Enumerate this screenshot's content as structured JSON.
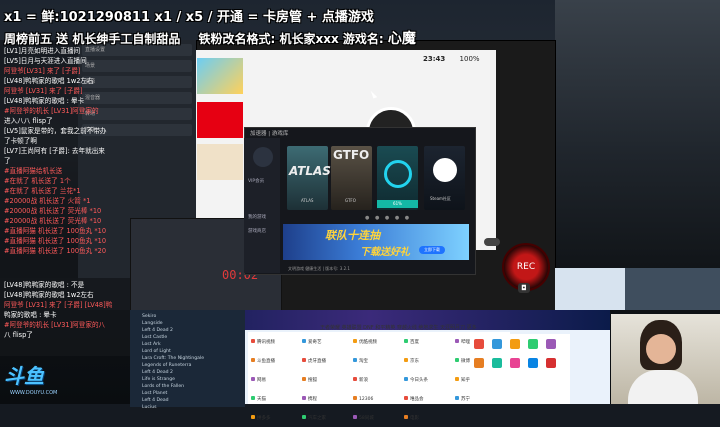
{
  "banner": {
    "line1": "x1 = 鲜:1021290811  x1 / x5 / 开通 = 卡房管 + 点播游戏",
    "line2_a": "周榜前五 送 机长绅手工自制甜品",
    "line2_b": "铁粉改名格式: 机长家xxx 游戏名:",
    "line2_name": "心魔"
  },
  "chat": {
    "lines": [
      {
        "text": "[LV1]月亮如明进入直播间",
        "color": "white"
      },
      {
        "text": "[LV5]日月与天涯进入直播间",
        "color": "white"
      },
      {
        "text": "阿登爷[LV31] 来了 [子爵]",
        "color": "red"
      },
      {
        "text": "[LV48]鸭鸭家的歌唱  1w2左右",
        "color": "white"
      },
      {
        "text": "阿登爷 [LV31] 来了 [子爵]",
        "color": "red"
      },
      {
        "text": "[LV48]鸭鸭家的歌唱 : 晕卡",
        "color": "white"
      },
      {
        "text": "#阿登爷的机长 [LV31]阿登家的",
        "color": "red"
      },
      {
        "text": "进入八八 flisp了",
        "color": "white"
      },
      {
        "text": "[LV5]鼠家是带的，套我之前不带办",
        "color": "white"
      },
      {
        "text": "了卡顿了啊",
        "color": "white"
      },
      {
        "text": "[LV7]王尚阿有 [子爵]: 去年就出来",
        "color": "white"
      },
      {
        "text": "了",
        "color": "white"
      },
      {
        "text": "#直播阿猫给机长送",
        "color": "red"
      },
      {
        "text": "#在就了 机长送了 1个",
        "color": "red"
      },
      {
        "text": "#在就了 机长送了 兰花*1",
        "color": "red"
      },
      {
        "text": "#20000战 机长送了 火箭 *1",
        "color": "red"
      },
      {
        "text": "#20000战 机长送了 荧光棒 *10",
        "color": "red"
      },
      {
        "text": "#20000战 机长送了 荧光棒 *10",
        "color": "red"
      },
      {
        "text": "#直播阿猫 机长送了 100鱼丸 *10",
        "color": "red"
      },
      {
        "text": "#直播阿猫 机长送了 100鱼丸 *10",
        "color": "red"
      },
      {
        "text": "#直播阿猫 机长送了 100鱼丸 *20",
        "color": "red"
      }
    ],
    "lower_lines": [
      {
        "text": "[LV48]鸭鸭家的歌唱 : 不是",
        "color": "white"
      },
      {
        "text": "[LV48]鸭鸭家的歌唱  1w2左右",
        "color": "white"
      },
      {
        "text": "阿登爷 [LV31] 来了 [子爵] [LV48]鸭",
        "color": "red"
      },
      {
        "text": "鸭家的歌唱 : 晕卡",
        "color": "white"
      },
      {
        "text": "#阿登爷的机长 [LV31]阿登家的八",
        "color": "red"
      },
      {
        "text": "八 flisp了",
        "color": "white"
      }
    ]
  },
  "midstrip": {
    "rows": [
      "直播设置",
      "场景",
      "来源",
      "混音器",
      "转场",
      "控件"
    ]
  },
  "switch": {
    "time": "23:43",
    "battery": "100%",
    "footer_label": "游戏"
  },
  "launcher": {
    "title": "加速器 | 游戏库",
    "side_items": [
      "我的游戏",
      "游戏商店"
    ],
    "user_label": "VIP会员",
    "games": [
      {
        "title": "ATLAS",
        "label": "ATLAS"
      },
      {
        "title": "GTFO",
        "label": "GTFO"
      },
      {
        "title": "",
        "label": "加速中"
      },
      {
        "title": "",
        "label": "Steam社区"
      }
    ],
    "progress": "61%",
    "dots": "● ● ● ● ●",
    "banner_text1": "联队十连抽",
    "banner_text2": "下载送好礼",
    "banner_btn": "立即下载",
    "footer": "文明游戏 健康生活 | 版本号: 3.2.1"
  },
  "recorder": {
    "timer": "00:02",
    "rec_label": "REC",
    "cam_icon": "camera-icon"
  },
  "steam_list": {
    "items": [
      "Sekiro",
      "Langside",
      "Left 4 Dead 2",
      "Lost Castle",
      "Lost Ark",
      "Lord of Light",
      "Lara Croft: The Nightingale",
      "Legends of Runeterra",
      "Left 4 Dead 2",
      "Life is Strange",
      "Lords of the Fallen",
      "Lost Planet",
      "Left 4 Dead",
      "Lucius"
    ]
  },
  "browser": {
    "nav": "王者荣耀  英雄联盟  DNF  和平精英  穿越火线  绝地求生  天涯明月刀  更多",
    "sites": [
      "腾讯视频",
      "爱奇艺",
      "优酷视频",
      "百度",
      "哔哩哔哩",
      "斗鱼直播",
      "虎牙直播",
      "淘宝",
      "京东",
      "微博",
      "网易",
      "搜狐",
      "新浪",
      "今日头条",
      "知乎",
      "天猫",
      "携程",
      "12306",
      "唯品会",
      "苏宁",
      "拼多多",
      "汽车之家",
      "58同城",
      "电影"
    ]
  },
  "logo": {
    "text": "斗鱼",
    "url": "WWW.DOUYU.COM"
  }
}
